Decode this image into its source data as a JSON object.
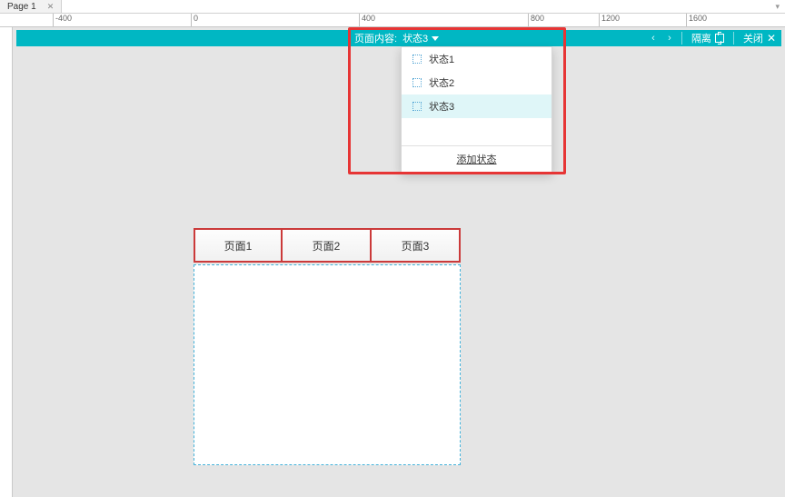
{
  "pageTab": {
    "label": "Page 1"
  },
  "ruler": {
    "labels": [
      "-400",
      "0",
      "400",
      "800",
      "1200",
      "1600"
    ],
    "pxPositions": [
      58,
      210,
      395,
      581,
      659,
      755
    ]
  },
  "controlBar": {
    "label": "页面内容:",
    "selected": "状态3",
    "isolate": "隔离",
    "close": "关闭"
  },
  "stateDropdown": {
    "options": [
      {
        "label": "状态1",
        "selected": false
      },
      {
        "label": "状态2",
        "selected": false
      },
      {
        "label": "状态3",
        "selected": true
      }
    ],
    "addLabel": "添加状态"
  },
  "tabs": [
    "页面1",
    "页面2",
    "页面3"
  ]
}
